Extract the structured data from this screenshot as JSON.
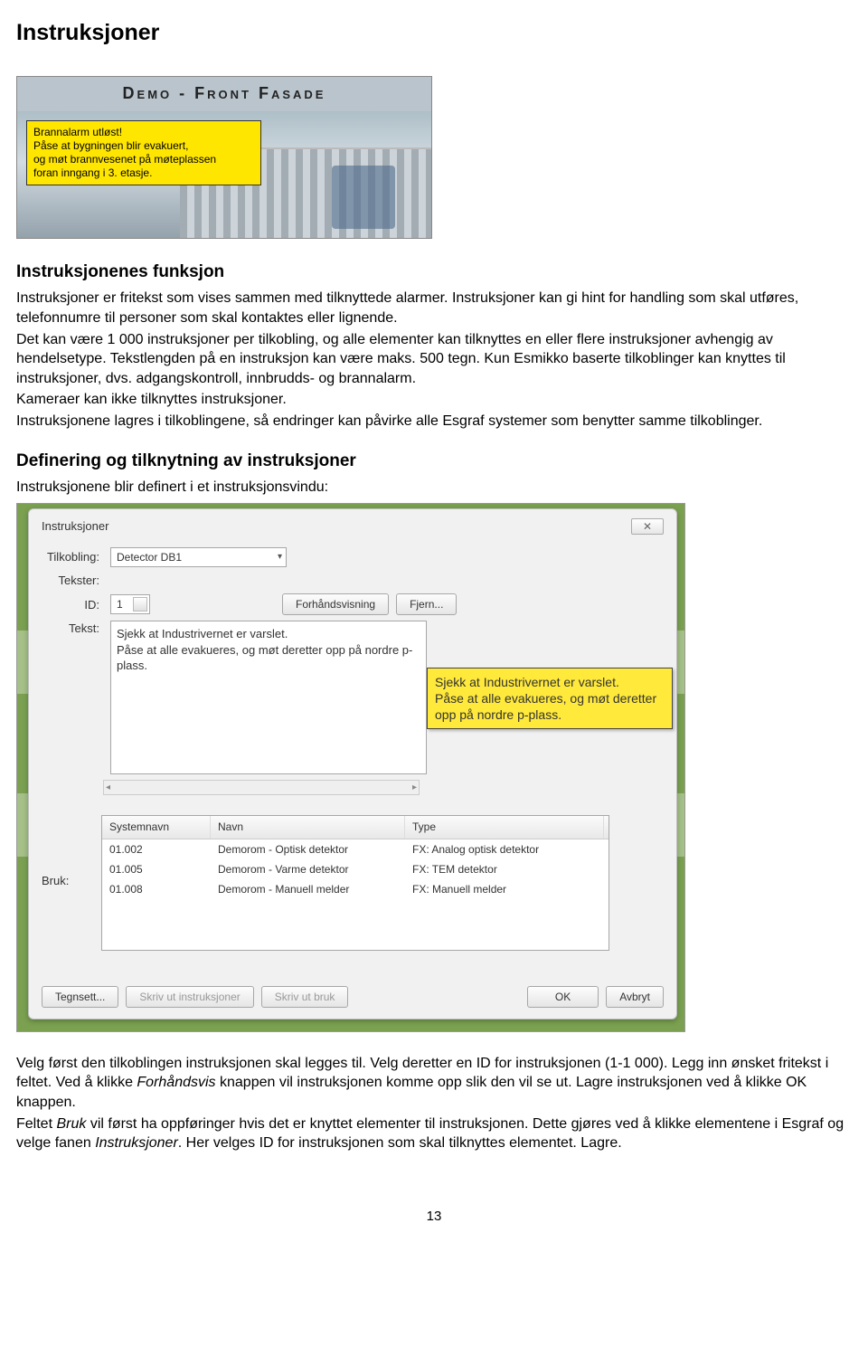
{
  "headings": {
    "h1": "Instruksjoner",
    "h2a": "Instruksjonenes funksjon",
    "h2b": "Definering og tilknytning av instruksjoner"
  },
  "paragraphs": {
    "p1": "Instruksjoner er fritekst som vises sammen med tilknyttede alarmer. Instruksjoner kan gi hint for handling som skal utføres, telefonnumre til personer som skal kontaktes eller lignende.",
    "p2": "Det kan være 1 000 instruksjoner per tilkobling, og alle elementer kan tilknyttes en eller flere instruksjoner avhengig av hendelsetype. Tekstlengden på en instruksjon kan være maks. 500 tegn. Kun Esmikko baserte tilkoblinger kan knyttes til instruksjoner, dvs. adgangskontroll, innbrudds- og brannalarm.",
    "p3": "Kameraer kan ikke tilknyttes instruksjoner.",
    "p4": "Instruksjonene lagres i tilkoblingene, så endringer kan påvirke alle Esgraf systemer som benytter samme tilkoblinger.",
    "p5": "Instruksjonene blir definert i et instruksjonsvindu:",
    "p6a": "Velg først den tilkoblingen instruksjonen skal legges til. Velg deretter en ID for instruksjonen (1-1 000). Legg inn ønsket fritekst i feltet. Ved å klikke ",
    "p6b_italic": "Forhåndsvis",
    "p6c": " knappen vil instruksjonen komme opp slik den vil se ut. Lagre instruksjonen ved å klikke OK knappen.",
    "p7a": "Feltet ",
    "p7b_italic": "Bruk",
    "p7c": " vil først ha oppføringer hvis det er knyttet elementer til instruksjonen. Dette gjøres ved å klikke elementene i Esgraf og velge fanen ",
    "p7d_italic": "Instruksjoner",
    "p7e": ". Her velges ID for instruksjonen som skal tilknyttes elementet. Lagre."
  },
  "banner": {
    "title": "Demo - Front Fasade",
    "note_l1": "Brannalarm utløst!",
    "note_l2": "Påse at bygningen blir evakuert,",
    "note_l3": "og møt brannvesenet på møteplassen",
    "note_l4": "foran inngang i 3. etasje."
  },
  "dialog": {
    "title": "Instruksjoner",
    "close": "✕",
    "labels": {
      "tilkobling": "Tilkobling:",
      "tekster": "Tekster:",
      "id": "ID:",
      "tekst": "Tekst:",
      "bruk": "Bruk:"
    },
    "tilkobling_value": "Detector DB1",
    "id_value": "1",
    "buttons": {
      "forhandsvisning": "Forhåndsvisning",
      "fjern": "Fjern...",
      "tegnsett": "Tegnsett...",
      "skriv_instr": "Skriv ut instruksjoner",
      "skriv_bruk": "Skriv ut bruk",
      "ok": "OK",
      "avbryt": "Avbryt"
    },
    "tekst_value": "Sjekk at Industrivernet er varslet.\nPåse at alle evakueres, og møt deretter opp på nordre p-plass.",
    "tooltip": "Sjekk at Industrivernet er varslet.\nPåse at alle evakueres, og møt deretter opp på nordre p-plass.",
    "table": {
      "headers": {
        "c1": "Systemnavn",
        "c2": "Navn",
        "c3": "Type"
      },
      "rows": [
        {
          "c1": "01.002",
          "c2": "Demorom - Optisk detektor",
          "c3": "FX: Analog optisk detektor"
        },
        {
          "c1": "01.005",
          "c2": "Demorom - Varme detektor",
          "c3": "FX: TEM detektor"
        },
        {
          "c1": "01.008",
          "c2": "Demorom - Manuell melder",
          "c3": "FX: Manuell melder"
        }
      ]
    }
  },
  "page_number": "13"
}
